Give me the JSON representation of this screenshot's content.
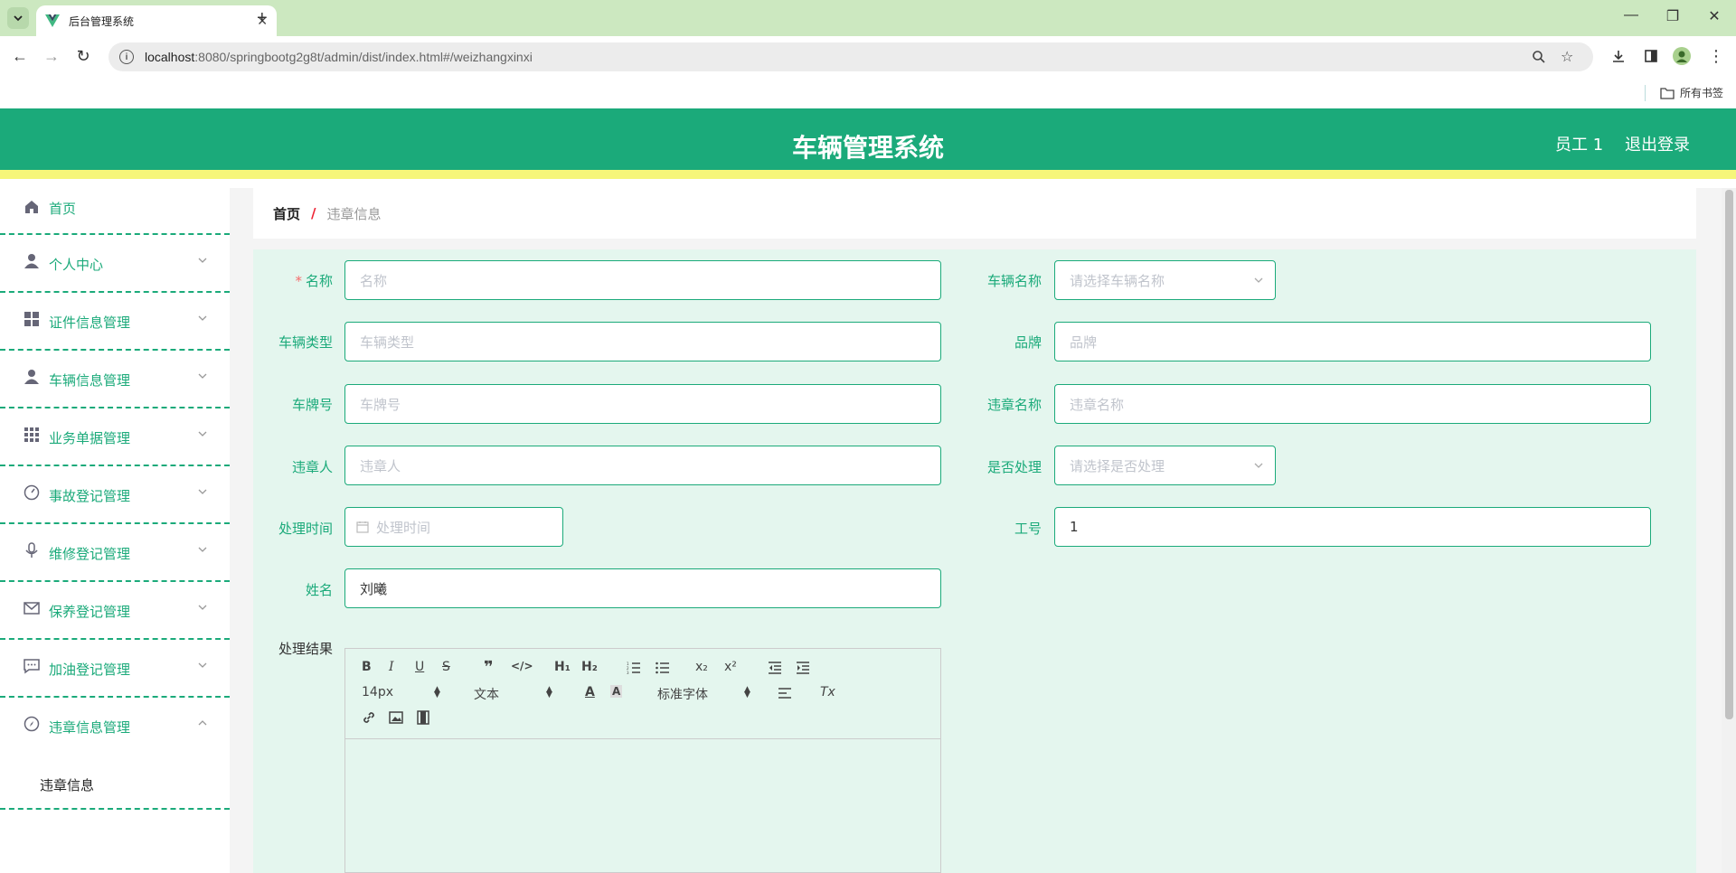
{
  "browser": {
    "tab_title": "后台管理系统",
    "url_host": "localhost",
    "url_rest": ":8080/springbootg2g8t/admin/dist/index.html#/weizhangxinxi",
    "bookmarks_label": "所有书签"
  },
  "header": {
    "title": "车辆管理系统",
    "user": "员工 1",
    "logout": "退出登录"
  },
  "sidebar": {
    "items": [
      {
        "label": "首页",
        "icon": "home-icon"
      },
      {
        "label": "个人中心",
        "icon": "user-icon"
      },
      {
        "label": "证件信息管理",
        "icon": "grid-icon"
      },
      {
        "label": "车辆信息管理",
        "icon": "user-icon"
      },
      {
        "label": "业务单据管理",
        "icon": "apps-icon"
      },
      {
        "label": "事故登记管理",
        "icon": "gauge-icon"
      },
      {
        "label": "维修登记管理",
        "icon": "mic-icon"
      },
      {
        "label": "保养登记管理",
        "icon": "mail-icon"
      },
      {
        "label": "加油登记管理",
        "icon": "chat-icon"
      },
      {
        "label": "违章信息管理",
        "icon": "compass-icon"
      }
    ],
    "sub_item": "违章信息"
  },
  "breadcrumb": {
    "home": "首页",
    "separator": "/",
    "current": "违章信息"
  },
  "form": {
    "name_label": "名称",
    "name_placeholder": "名称",
    "vehicle_name_label": "车辆名称",
    "vehicle_name_placeholder": "请选择车辆名称",
    "vehicle_type_label": "车辆类型",
    "vehicle_type_placeholder": "车辆类型",
    "brand_label": "品牌",
    "brand_placeholder": "品牌",
    "plate_label": "车牌号",
    "plate_placeholder": "车牌号",
    "violation_name_label": "违章名称",
    "violation_name_placeholder": "违章名称",
    "violator_label": "违章人",
    "violator_placeholder": "违章人",
    "handled_label": "是否处理",
    "handled_placeholder": "请选择是否处理",
    "handle_time_label": "处理时间",
    "handle_time_placeholder": "处理时间",
    "job_no_label": "工号",
    "job_no_value": "1",
    "full_name_label": "姓名",
    "full_name_value": "刘曦",
    "result_label": "处理结果"
  },
  "editor": {
    "h1": "H₁",
    "h2": "H₂",
    "sub": "x₂",
    "sup": "x²",
    "size_value": "14px",
    "format_value": "文本",
    "font_value": "标准字体",
    "clean": "Tx"
  },
  "colors": {
    "primary": "#1baa7a",
    "accent_strip": "#f6f67a",
    "form_bg": "#e4f6ee"
  }
}
